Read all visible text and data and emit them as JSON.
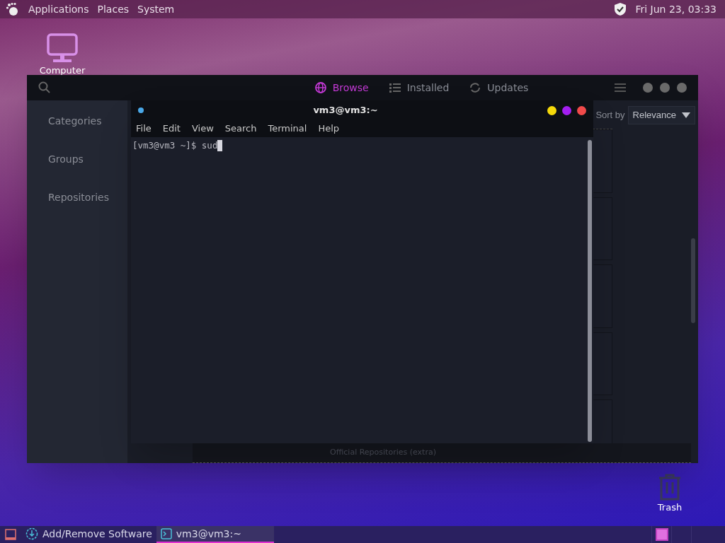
{
  "top_panel": {
    "menus": [
      "Applications",
      "Places",
      "System"
    ],
    "clock": "Fri Jun 23, 03:33"
  },
  "desktop_icons": [
    {
      "label": "Computer",
      "kind": "computer"
    },
    {
      "label": "Trash",
      "kind": "trash"
    }
  ],
  "software_window": {
    "tabs": [
      {
        "label": "Browse",
        "selected": true
      },
      {
        "label": "Installed",
        "selected": false
      },
      {
        "label": "Updates",
        "selected": false
      }
    ],
    "sidebar": [
      "Categories",
      "Groups",
      "Repositories"
    ],
    "sort_label": "Sort by",
    "sort_value": "Relevance",
    "repository_caption": "Official Repositories (extra)"
  },
  "terminal": {
    "title": "vm3@vm3:~",
    "menu": [
      "File",
      "Edit",
      "View",
      "Search",
      "Terminal",
      "Help"
    ],
    "prompt": "[vm3@vm3 ~]$ sud"
  },
  "taskbar": {
    "tasks": [
      {
        "label": "Add/Remove Software",
        "kind": "software",
        "selected": false
      },
      {
        "label": "vm3@vm3:~",
        "kind": "terminal",
        "selected": true
      }
    ],
    "workspaces": [
      {
        "selected": true
      },
      {
        "selected": false
      },
      {
        "selected": false
      }
    ]
  }
}
